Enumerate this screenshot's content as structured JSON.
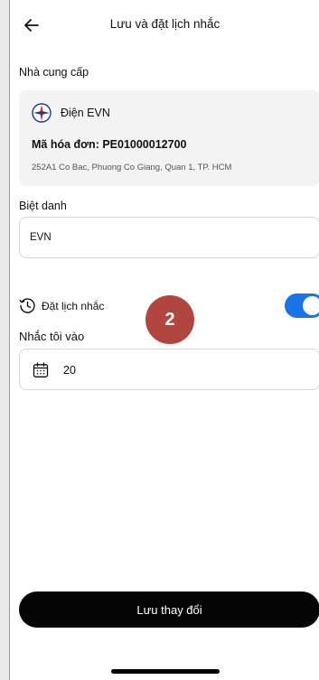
{
  "header": {
    "title": "Lưu và đặt lịch nhắc",
    "back_icon": "arrow-left-icon"
  },
  "provider_section": {
    "label": "Nhà cung cấp",
    "provider_name": "Điện EVN",
    "bill_code": "Mã hóa đơn: PE01000012700",
    "address": "252A1 Co Bac, Phuong Co Giang, Quan 1, TP. HCM"
  },
  "nickname": {
    "label": "Biệt danh",
    "value": "EVN"
  },
  "reminder": {
    "label": "Đặt lịch nhắc",
    "enabled": true,
    "icon": "clock-history-icon",
    "accent_color": "#1a73e8"
  },
  "remind_at": {
    "label": "Nhắc tôi vào",
    "value": "20",
    "icon": "calendar-icon"
  },
  "step_badge": {
    "number": "2",
    "color": "#b0463f"
  },
  "save_button": {
    "label": "Lưu thay đổi"
  }
}
